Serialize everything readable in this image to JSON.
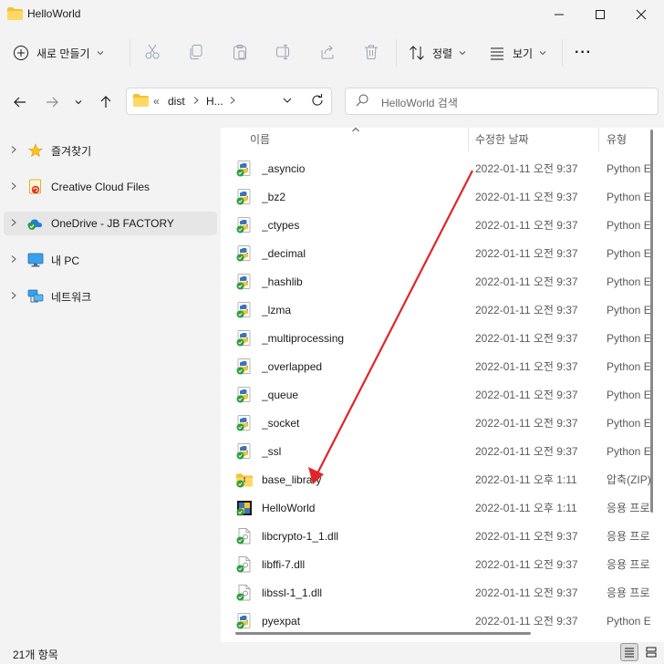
{
  "window": {
    "title": "HelloWorld"
  },
  "toolbar": {
    "new_label": "새로 만들기",
    "sort_label": "정렬",
    "view_label": "보기",
    "more_label": "···"
  },
  "address": {
    "overflow": "«",
    "crumbs": [
      "dist",
      "H..."
    ],
    "search_placeholder": "HelloWorld 검색"
  },
  "nav": {
    "items": [
      {
        "label": "즐겨찾기",
        "icon": "star-icon"
      },
      {
        "label": "Creative Cloud Files",
        "icon": "creative-cloud-icon"
      },
      {
        "label": "OneDrive - JB FACTORY",
        "icon": "onedrive-icon",
        "selected": true
      },
      {
        "label": "내 PC",
        "icon": "pc-icon"
      },
      {
        "label": "네트워크",
        "icon": "network-icon"
      }
    ]
  },
  "columns": {
    "name": "이름",
    "date": "수정한 날짜",
    "type": "유형"
  },
  "files": [
    {
      "name": "_asyncio",
      "date": "2022-01-11 오전 9:37",
      "type": "Python Ext",
      "icon": "python-icon"
    },
    {
      "name": "_bz2",
      "date": "2022-01-11 오전 9:37",
      "type": "Python Ext",
      "icon": "python-icon"
    },
    {
      "name": "_ctypes",
      "date": "2022-01-11 오전 9:37",
      "type": "Python Ext",
      "icon": "python-icon"
    },
    {
      "name": "_decimal",
      "date": "2022-01-11 오전 9:37",
      "type": "Python Ext",
      "icon": "python-icon"
    },
    {
      "name": "_hashlib",
      "date": "2022-01-11 오전 9:37",
      "type": "Python Ext",
      "icon": "python-icon"
    },
    {
      "name": "_lzma",
      "date": "2022-01-11 오전 9:37",
      "type": "Python Ext",
      "icon": "python-icon"
    },
    {
      "name": "_multiprocessing",
      "date": "2022-01-11 오전 9:37",
      "type": "Python Ext",
      "icon": "python-icon"
    },
    {
      "name": "_overlapped",
      "date": "2022-01-11 오전 9:37",
      "type": "Python Ext",
      "icon": "python-icon"
    },
    {
      "name": "_queue",
      "date": "2022-01-11 오전 9:37",
      "type": "Python Ext",
      "icon": "python-icon"
    },
    {
      "name": "_socket",
      "date": "2022-01-11 오전 9:37",
      "type": "Python Ext",
      "icon": "python-icon"
    },
    {
      "name": "_ssl",
      "date": "2022-01-11 오전 9:37",
      "type": "Python Ext",
      "icon": "python-icon"
    },
    {
      "name": "base_library",
      "date": "2022-01-11 오후 1:11",
      "type": "압축(ZIP)",
      "icon": "zip-folder-icon"
    },
    {
      "name": "HelloWorld",
      "date": "2022-01-11 오후 1:11",
      "type": "응용 프로",
      "icon": "exe-icon"
    },
    {
      "name": "libcrypto-1_1.dll",
      "date": "2022-01-11 오전 9:37",
      "type": "응용 프로",
      "icon": "dll-icon"
    },
    {
      "name": "libffi-7.dll",
      "date": "2022-01-11 오전 9:37",
      "type": "응용 프로",
      "icon": "dll-icon"
    },
    {
      "name": "libssl-1_1.dll",
      "date": "2022-01-11 오전 9:37",
      "type": "응용 프로",
      "icon": "dll-icon"
    },
    {
      "name": "pyexpat",
      "date": "2022-01-11 오전 9:37",
      "type": "Python Ext",
      "icon": "python-icon"
    }
  ],
  "status": {
    "count": "21개 항목"
  },
  "colors": {
    "annotation_arrow": "#e0252a",
    "sync_check": "#2e9d3a",
    "folder": "#f5c12f",
    "selection": "#e6e6e6"
  }
}
